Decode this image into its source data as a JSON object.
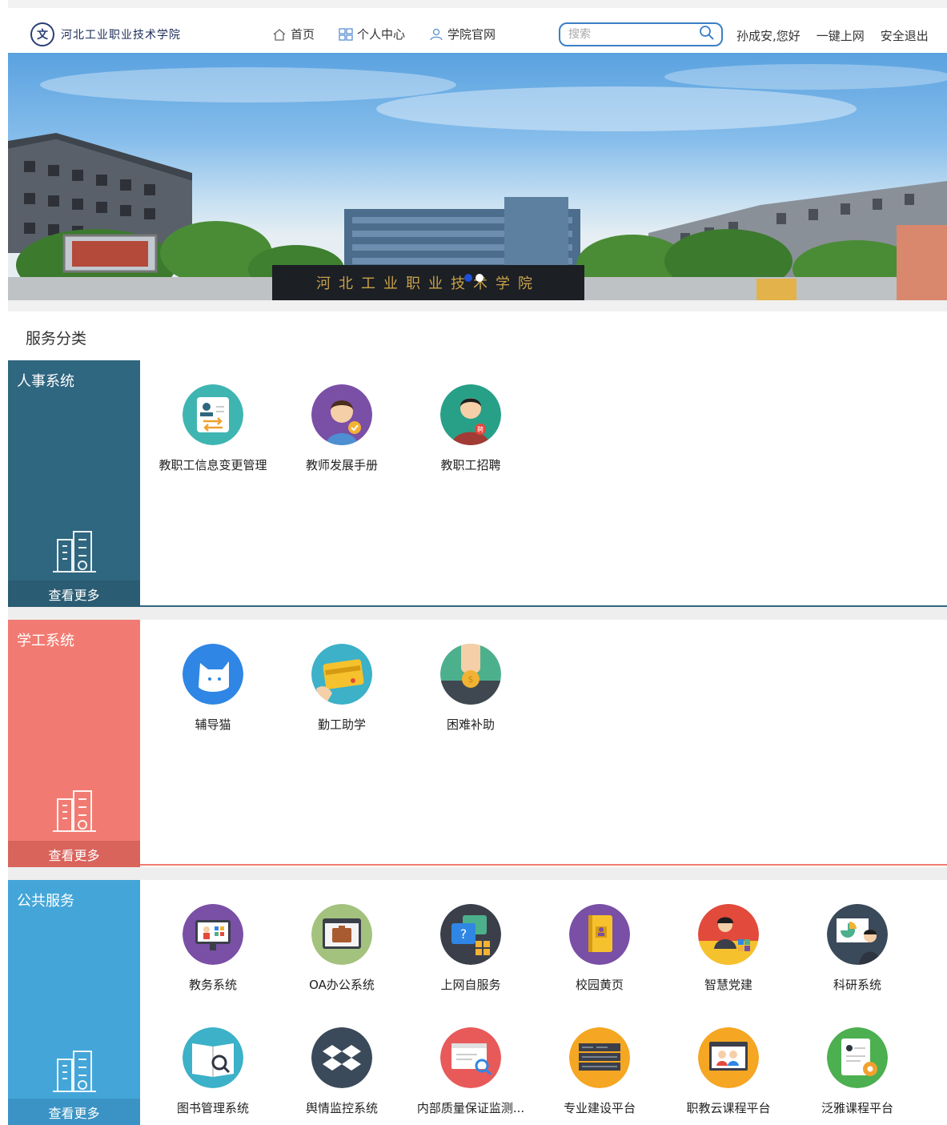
{
  "header": {
    "logo_seal": "文",
    "school_name": "河北工业职业技术学院",
    "nav": [
      {
        "label": "首页",
        "icon": "home-icon"
      },
      {
        "label": "个人中心",
        "icon": "grid-icon"
      },
      {
        "label": "学院官网",
        "icon": "person-icon"
      }
    ],
    "search_placeholder": "搜索",
    "greeting": "孙成安,您好",
    "one_click_internet": "一键上网",
    "logout": "安全退出"
  },
  "banner": {
    "gate_text": "河北工业职业技术学院",
    "slide_count": 2,
    "active_slide": 1
  },
  "section_title": "服务分类",
  "panels": [
    {
      "title": "人事系统",
      "more": "查看更多",
      "color": "#2f6680",
      "apps": [
        {
          "label": "教职工信息变更管理",
          "icon": "profile-change-icon"
        },
        {
          "label": "教师发展手册",
          "icon": "teacher-badge-icon"
        },
        {
          "label": "教职工招聘",
          "icon": "recruit-icon"
        }
      ]
    },
    {
      "title": "学工系统",
      "more": "查看更多",
      "color": "#f17b72",
      "apps": [
        {
          "label": "辅导猫",
          "icon": "cat-icon"
        },
        {
          "label": "勤工助学",
          "icon": "card-icon"
        },
        {
          "label": "困难补助",
          "icon": "coin-hand-icon"
        }
      ]
    },
    {
      "title": "公共服务",
      "more": "查看更多",
      "color": "#44a6d8",
      "apps": [
        {
          "label": "教务系统",
          "icon": "teaching-screen-icon"
        },
        {
          "label": "OA办公系统",
          "icon": "briefcase-icon"
        },
        {
          "label": "上网自服务",
          "icon": "help-chat-icon"
        },
        {
          "label": "校园黄页",
          "icon": "yellow-book-icon"
        },
        {
          "label": "智慧党建",
          "icon": "party-icon"
        },
        {
          "label": "科研系统",
          "icon": "research-chart-icon"
        },
        {
          "label": "图书管理系统",
          "icon": "book-search-icon"
        },
        {
          "label": "舆情监控系统",
          "icon": "dropbox-icon"
        },
        {
          "label": "内部质量保证监测...",
          "icon": "quality-monitor-icon"
        },
        {
          "label": "专业建设平台",
          "icon": "server-rack-icon"
        },
        {
          "label": "职教云课程平台",
          "icon": "cloud-class-icon"
        },
        {
          "label": "泛雅课程平台",
          "icon": "course-gear-icon"
        }
      ]
    }
  ]
}
